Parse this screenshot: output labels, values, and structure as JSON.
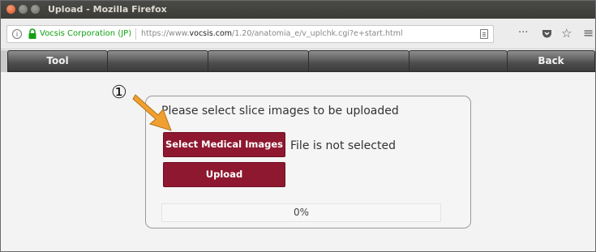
{
  "window": {
    "title": "Upload - Mozilla Firefox"
  },
  "address_bar": {
    "site_identity": "Vocsis Corporation (JP)",
    "url_prefix": "https://www.",
    "url_domain": "vocsis.com",
    "url_path": "/1.20/anatomia_e/v_uplchk.cgi?e+start.html",
    "info_icon": "i",
    "menu_glyph": "···",
    "pocket_icon": "pocket-icon",
    "bookmark_glyph": "☆",
    "hamburger_glyph": "≡"
  },
  "toolbar": {
    "buttons": [
      "Tool",
      "",
      "",
      "",
      "",
      "Back"
    ]
  },
  "upload": {
    "heading": "Please select slice images to be uploaded",
    "select_button": "Select Medical Images",
    "file_status": "File is not selected",
    "upload_button": "Upload",
    "progress_percent": 0,
    "progress_label": "0%"
  },
  "annotation": {
    "step": "①",
    "arrow_color": "#f0a030"
  },
  "colors": {
    "button_red": "#8e1830",
    "toolbar_dark": "#3c3c3c",
    "site_green": "#12a012"
  }
}
